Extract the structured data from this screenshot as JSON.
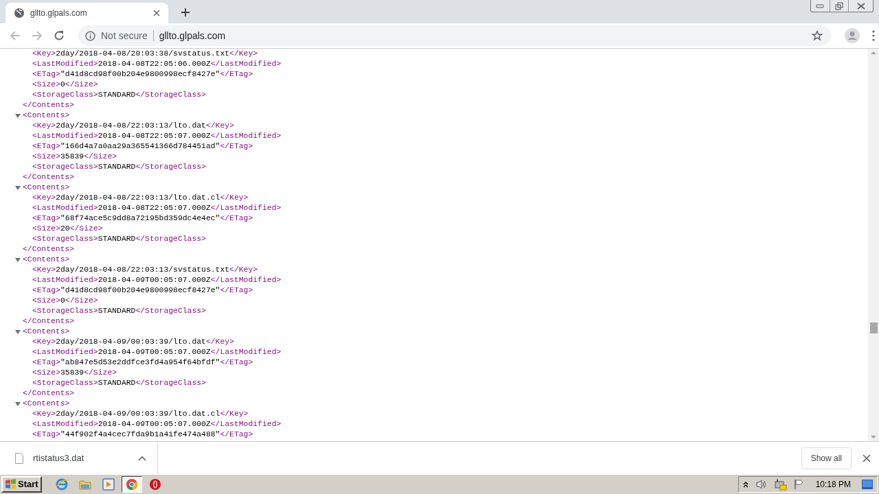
{
  "browser": {
    "tab": {
      "title": "gllto.glpals.com",
      "selected": true
    },
    "omnibox": {
      "security": "Not secure",
      "url": "gllto.glpals.com"
    }
  },
  "xml": {
    "top_fragment": {
      "children": [
        {
          "open": "<Key>",
          "value": "2day/2018-04-08/20:03:38/svstatus.txt",
          "close": "</Key>"
        },
        {
          "open": "<LastModified>",
          "value": "2018-04-08T22:05:06.000Z",
          "close": "</LastModified>"
        },
        {
          "open": "<ETag>",
          "value": "\"d41d8cd98f00b204e9800998ecf8427e\"",
          "close": "</ETag>"
        },
        {
          "open": "<Size>",
          "value": "0",
          "close": "</Size>"
        },
        {
          "open": "<StorageClass>",
          "value": "STANDARD",
          "close": "</StorageClass>"
        }
      ],
      "close": "</Contents>"
    },
    "nodes": [
      {
        "open": "<Contents>",
        "expanded": true,
        "close": "</Contents>",
        "children": [
          {
            "open": "<Key>",
            "value": "2day/2018-04-08/22:03:13/lto.dat",
            "close": "</Key>"
          },
          {
            "open": "<LastModified>",
            "value": "2018-04-08T22:05:07.000Z",
            "close": "</LastModified>"
          },
          {
            "open": "<ETag>",
            "value": "\"166d4a7a0aa29a365541366d784451ad\"",
            "close": "</ETag>"
          },
          {
            "open": "<Size>",
            "value": "35839",
            "close": "</Size>"
          },
          {
            "open": "<StorageClass>",
            "value": "STANDARD",
            "close": "</StorageClass>"
          }
        ]
      },
      {
        "open": "<Contents>",
        "expanded": true,
        "close": "</Contents>",
        "children": [
          {
            "open": "<Key>",
            "value": "2day/2018-04-08/22:03:13/lto.dat.cl",
            "close": "</Key>"
          },
          {
            "open": "<LastModified>",
            "value": "2018-04-08T22:05:07.000Z",
            "close": "</LastModified>"
          },
          {
            "open": "<ETag>",
            "value": "\"68f74ace5c9dd8a72195bd359dc4e4ec\"",
            "close": "</ETag>"
          },
          {
            "open": "<Size>",
            "value": "20",
            "close": "</Size>"
          },
          {
            "open": "<StorageClass>",
            "value": "STANDARD",
            "close": "</StorageClass>"
          }
        ]
      },
      {
        "open": "<Contents>",
        "expanded": true,
        "close": "</Contents>",
        "children": [
          {
            "open": "<Key>",
            "value": "2day/2018-04-08/22:03:13/svstatus.txt",
            "close": "</Key>"
          },
          {
            "open": "<LastModified>",
            "value": "2018-04-09T00:05:07.000Z",
            "close": "</LastModified>"
          },
          {
            "open": "<ETag>",
            "value": "\"d41d8cd98f00b204e9800998ecf8427e\"",
            "close": "</ETag>"
          },
          {
            "open": "<Size>",
            "value": "0",
            "close": "</Size>"
          },
          {
            "open": "<StorageClass>",
            "value": "STANDARD",
            "close": "</StorageClass>"
          }
        ]
      },
      {
        "open": "<Contents>",
        "expanded": true,
        "close": "</Contents>",
        "children": [
          {
            "open": "<Key>",
            "value": "2day/2018-04-09/00:03:39/lto.dat",
            "close": "</Key>"
          },
          {
            "open": "<LastModified>",
            "value": "2018-04-09T00:05:07.000Z",
            "close": "</LastModified>"
          },
          {
            "open": "<ETag>",
            "value": "\"ab847e5d53e2ddfce3fd4a954f64bfdf\"",
            "close": "</ETag>"
          },
          {
            "open": "<Size>",
            "value": "35839",
            "close": "</Size>"
          },
          {
            "open": "<StorageClass>",
            "value": "STANDARD",
            "close": "</StorageClass>"
          }
        ]
      },
      {
        "open": "<Contents>",
        "expanded": true,
        "children": [
          {
            "open": "<Key>",
            "value": "2day/2018-04-09/00:03:39/lto.dat.cl",
            "close": "</Key>"
          },
          {
            "open": "<LastModified>",
            "value": "2018-04-09T00:05:07.000Z",
            "close": "</LastModified>"
          },
          {
            "open": "<ETag>",
            "value": "\"44f902f4a4cec7fda9b1a41fe474a488\"",
            "close": "</ETag>"
          }
        ]
      }
    ]
  },
  "download_bar": {
    "items": [
      {
        "filename": "rtistatus3.dat"
      }
    ],
    "show_all": "Show all"
  },
  "taskbar": {
    "start": "Start",
    "apps": [
      {
        "kind": "ie",
        "selected": false
      },
      {
        "kind": "explorer",
        "selected": false
      },
      {
        "kind": "media",
        "selected": false
      },
      {
        "kind": "chrome",
        "selected": true
      },
      {
        "kind": "opera",
        "selected": false
      }
    ],
    "clock": "10:18 PM"
  }
}
